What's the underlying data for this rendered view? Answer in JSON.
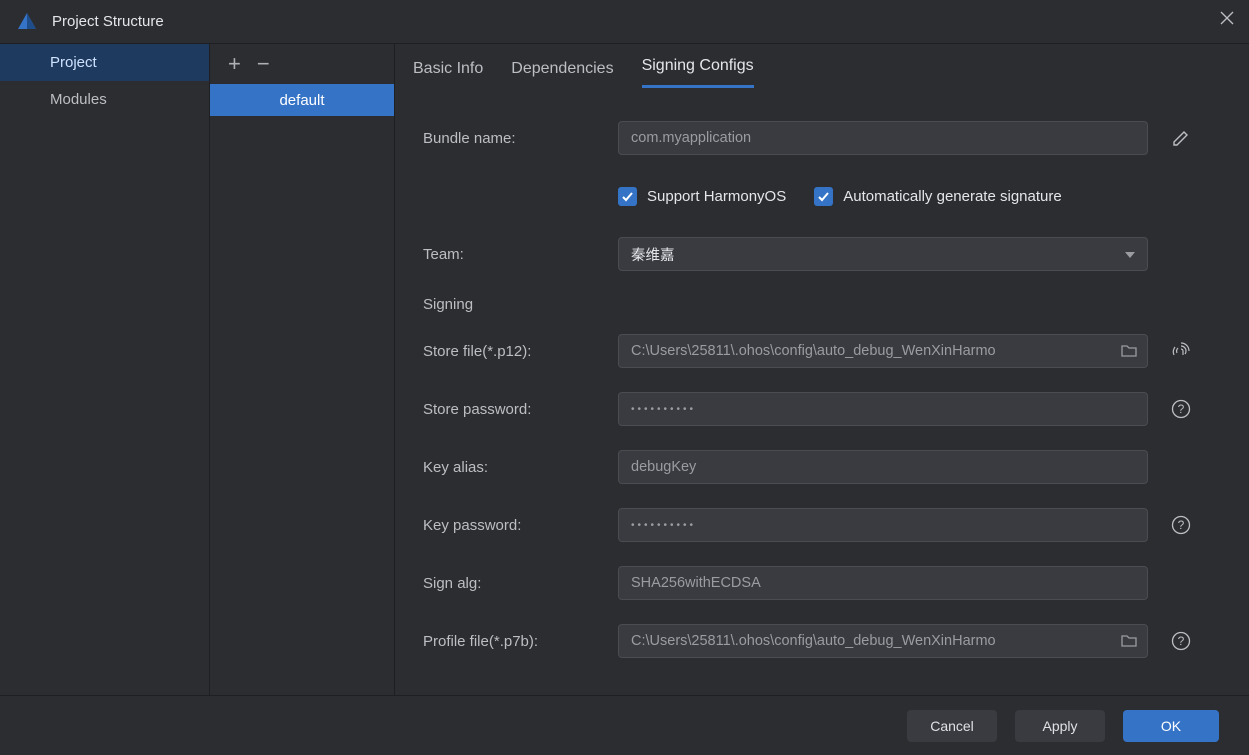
{
  "window": {
    "title": "Project Structure"
  },
  "left_panel": {
    "project": "Project",
    "modules": "Modules"
  },
  "config_list": {
    "default_item": "default"
  },
  "tabs": {
    "basic": "Basic Info",
    "deps": "Dependencies",
    "signing": "Signing Configs"
  },
  "form": {
    "bundle_label": "Bundle name:",
    "bundle_value": "com.myapplication",
    "chk_harmony": "Support HarmonyOS",
    "chk_auto_sig": "Automatically generate signature",
    "team_label": "Team:",
    "team_value": "秦维嘉",
    "section_signing": "Signing",
    "store_file_label": "Store file(*.p12):",
    "store_file_value": "C:\\Users\\25811\\.ohos\\config\\auto_debug_WenXinHarmo",
    "store_pwd_label": "Store password:",
    "store_pwd_value": "••••••••••",
    "key_alias_label": "Key alias:",
    "key_alias_value": "debugKey",
    "key_pwd_label": "Key password:",
    "key_pwd_value": "••••••••••",
    "sign_alg_label": "Sign alg:",
    "sign_alg_value": "SHA256withECDSA",
    "profile_label": "Profile file(*.p7b):",
    "profile_value": "C:\\Users\\25811\\.ohos\\config\\auto_debug_WenXinHarmo"
  },
  "footer": {
    "cancel": "Cancel",
    "apply": "Apply",
    "ok": "OK"
  }
}
